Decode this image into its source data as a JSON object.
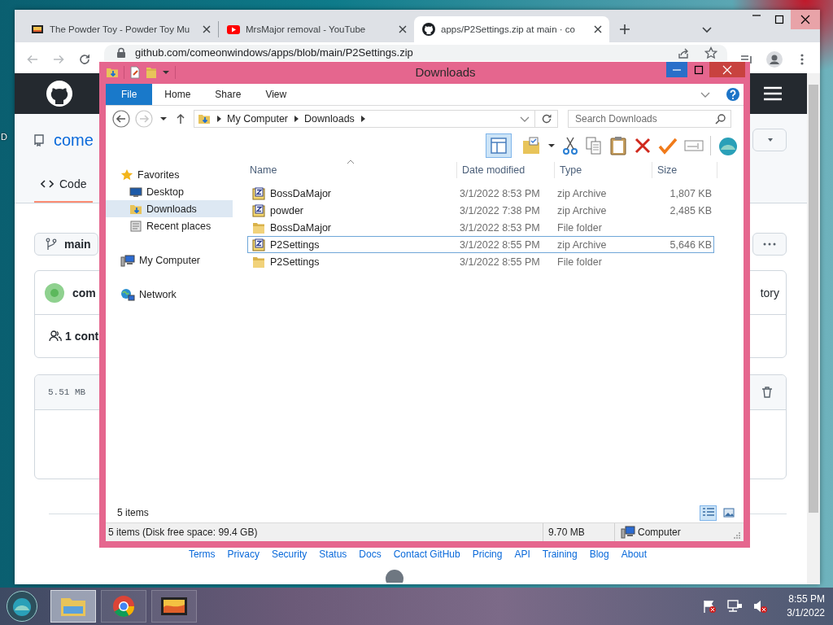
{
  "desktop": {
    "icon_label": "D"
  },
  "browser": {
    "tabs": [
      {
        "title": "The Powder Toy - Powder Toy Mu",
        "kind": "film",
        "selected": false
      },
      {
        "title": "MrsMajor removal - YouTube",
        "kind": "video",
        "selected": false
      },
      {
        "title": "apps/P2Settings.zip at main · co",
        "kind": "github",
        "selected": true
      }
    ],
    "address": "github.com/comeonwindows/apps/blob/main/P2Settings.zip",
    "page": {
      "owner": "come",
      "tabs": [
        {
          "label": "Code",
          "selected": true
        }
      ],
      "branch": "main",
      "commit_author": "com",
      "history_link": "tory",
      "contributors": "1 cont",
      "file_size": "5.51 MB",
      "footer_links": [
        "Terms",
        "Privacy",
        "Security",
        "Status",
        "Docs",
        "Contact GitHub",
        "Pricing",
        "API",
        "Training",
        "Blog",
        "About"
      ]
    }
  },
  "explorer": {
    "title": "Downloads",
    "ribbon_tabs": [
      {
        "label": "File",
        "kind": "menu"
      },
      {
        "label": "Home",
        "kind": "tab"
      },
      {
        "label": "Share",
        "kind": "tab"
      },
      {
        "label": "View",
        "kind": "tab"
      }
    ],
    "breadcrumb": [
      "My Computer",
      "Downloads"
    ],
    "search": {
      "placeholder": "Search Downloads"
    },
    "preview_pane": {
      "on": true
    },
    "nav": [
      {
        "label": "Favorites",
        "kind": "favorites",
        "selected": false,
        "children": [
          {
            "label": "Desktop",
            "kind": "desktop",
            "selected": false
          },
          {
            "label": "Downloads",
            "kind": "downloads",
            "selected": true
          },
          {
            "label": "Recent places",
            "kind": "recent",
            "selected": false
          }
        ]
      },
      {
        "label": "My Computer",
        "kind": "computer",
        "selected": false
      },
      {
        "label": "Network",
        "kind": "network",
        "selected": false
      }
    ],
    "columns": [
      "Name",
      "Date modified",
      "Type",
      "Size"
    ],
    "files": [
      {
        "name": "BossDaMajor",
        "date": "3/1/2022 8:53 PM",
        "type": "zip Archive",
        "size": "1,807 KB",
        "kind": "zip",
        "selected": false
      },
      {
        "name": "powder",
        "date": "3/1/2022 7:38 PM",
        "type": "zip Archive",
        "size": "2,485 KB",
        "kind": "zip",
        "selected": false
      },
      {
        "name": "BossDaMajor",
        "date": "3/1/2022 8:53 PM",
        "type": "File folder",
        "kind": "folder",
        "selected": false
      },
      {
        "name": "P2Settings",
        "date": "3/1/2022 8:55 PM",
        "type": "zip Archive",
        "size": "5,646 KB",
        "kind": "zip",
        "selected": true
      },
      {
        "name": "P2Settings",
        "date": "3/1/2022 8:55 PM",
        "type": "File folder",
        "kind": "folder",
        "selected": false
      }
    ],
    "item_count": "5 items",
    "views": [
      {
        "kind": "details",
        "selected": true
      },
      {
        "kind": "large_icons",
        "selected": false
      }
    ],
    "status": {
      "summary": "5 items (Disk free space: 99.4 GB)",
      "size": "9.70 MB",
      "location": "Computer"
    }
  },
  "taskbar": {
    "buttons": [
      {
        "kind": "explorer",
        "selected": true
      },
      {
        "kind": "browser",
        "selected": false
      },
      {
        "kind": "media",
        "selected": false
      }
    ],
    "time": "8:55 PM",
    "date": "3/1/2022"
  }
}
